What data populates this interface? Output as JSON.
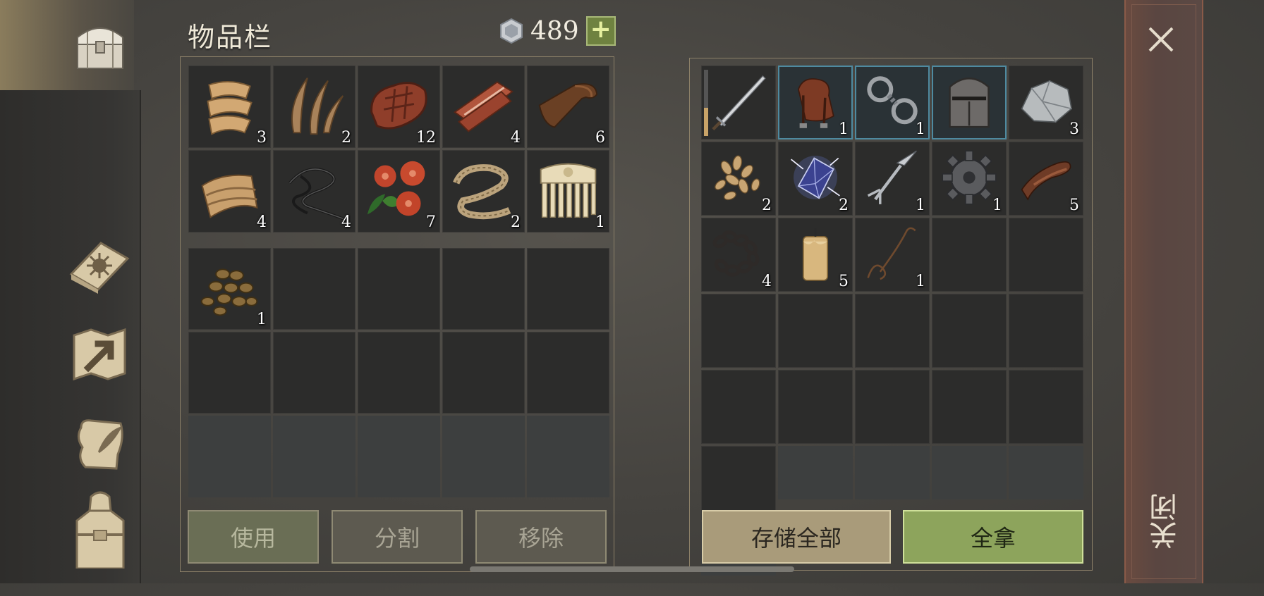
{
  "header": {
    "title": "物品栏",
    "currency_icon": "silver-coin-icon",
    "currency": "489",
    "add_label": "+"
  },
  "inventory": {
    "items": [
      {
        "icon": "cloth-icon",
        "count": "3"
      },
      {
        "icon": "fiber-icon",
        "count": "2"
      },
      {
        "icon": "meat-icon",
        "count": "12"
      },
      {
        "icon": "bacon-icon",
        "count": "4"
      },
      {
        "icon": "leather-icon",
        "count": "6"
      },
      {
        "icon": "folded-cloth-icon",
        "count": "4"
      },
      {
        "icon": "wire-icon",
        "count": "4"
      },
      {
        "icon": "berries-icon",
        "count": "7"
      },
      {
        "icon": "rope-icon",
        "count": "2"
      },
      {
        "icon": "comb-icon",
        "count": "1"
      }
    ],
    "bag_items": [
      {
        "icon": "nuts-icon",
        "count": "1"
      }
    ]
  },
  "actions": {
    "use": "使用",
    "split": "分割",
    "remove": "移除"
  },
  "container": {
    "items": [
      {
        "icon": "sword-icon",
        "count": ""
      },
      {
        "icon": "saddle-icon",
        "count": "1"
      },
      {
        "icon": "shackles-icon",
        "count": "1"
      },
      {
        "icon": "helmet-icon",
        "count": ""
      },
      {
        "icon": "ore-icon",
        "count": "3"
      },
      {
        "icon": "seeds-icon",
        "count": "2"
      },
      {
        "icon": "crystal-icon",
        "count": "2"
      },
      {
        "icon": "fork-icon",
        "count": "1"
      },
      {
        "icon": "gear-icon",
        "count": "1"
      },
      {
        "icon": "leather-strip-icon",
        "count": "5"
      },
      {
        "icon": "chain-icon",
        "count": "4"
      },
      {
        "icon": "candle-icon",
        "count": "5"
      },
      {
        "icon": "whip-icon",
        "count": "1"
      }
    ],
    "store_all": "存储全部",
    "take_all": "全拿"
  },
  "close": {
    "label": "关闭",
    "icon": "close-icon"
  },
  "nav": [
    {
      "icon": "chest-icon"
    },
    {
      "icon": "sun-book-icon"
    },
    {
      "icon": "map-arrow-icon"
    },
    {
      "icon": "quest-scroll-icon"
    },
    {
      "icon": "character-icon"
    }
  ],
  "colors": {
    "accent_green": "#8da45c",
    "highlight_blue": "#4e8aa0",
    "panel_border": "#8c8068"
  }
}
